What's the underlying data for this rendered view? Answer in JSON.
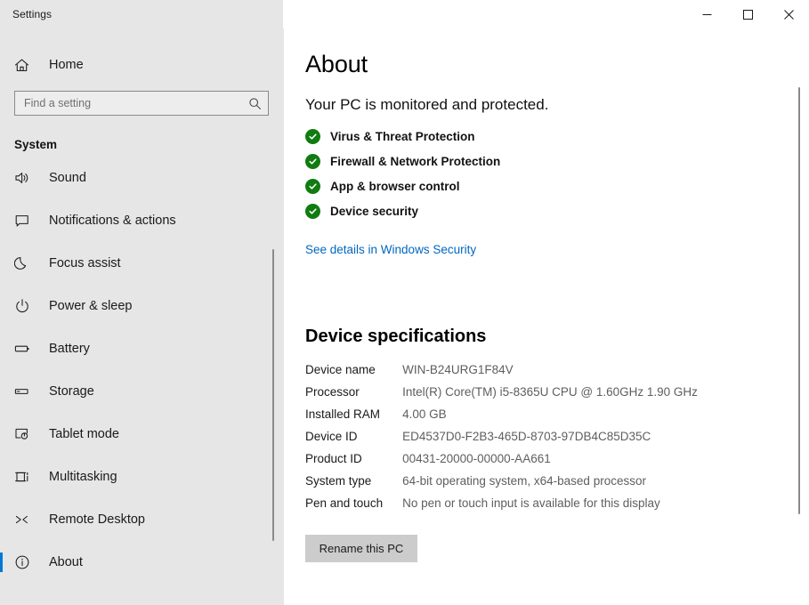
{
  "window": {
    "title": "Settings",
    "controls": {
      "minimize": "Minimize",
      "maximize": "Maximize",
      "close": "Close"
    }
  },
  "sidebar": {
    "home_label": "Home",
    "home_icon": "home-icon",
    "search": {
      "placeholder": "Find a setting",
      "value": "",
      "icon": "search-icon"
    },
    "group_title": "System",
    "items": [
      {
        "label": "Sound",
        "icon": "speaker-icon",
        "selected": false
      },
      {
        "label": "Notifications & actions",
        "icon": "notification-icon",
        "selected": false
      },
      {
        "label": "Focus assist",
        "icon": "moon-icon",
        "selected": false
      },
      {
        "label": "Power & sleep",
        "icon": "power-icon",
        "selected": false
      },
      {
        "label": "Battery",
        "icon": "battery-icon",
        "selected": false
      },
      {
        "label": "Storage",
        "icon": "storage-icon",
        "selected": false
      },
      {
        "label": "Tablet mode",
        "icon": "tablet-icon",
        "selected": false
      },
      {
        "label": "Multitasking",
        "icon": "multitasking-icon",
        "selected": false
      },
      {
        "label": "Remote Desktop",
        "icon": "remote-desktop-icon",
        "selected": false
      },
      {
        "label": "About",
        "icon": "info-icon",
        "selected": true
      }
    ]
  },
  "main": {
    "page_title": "About",
    "subtitle": "Your PC is monitored and protected.",
    "security_status": [
      {
        "label": "Virus & Threat Protection",
        "icon": "check-circle-icon",
        "state": "ok"
      },
      {
        "label": "Firewall & Network Protection",
        "icon": "check-circle-icon",
        "state": "ok"
      },
      {
        "label": "App & browser control",
        "icon": "check-circle-icon",
        "state": "ok"
      },
      {
        "label": "Device security",
        "icon": "check-circle-icon",
        "state": "ok"
      }
    ],
    "security_link": "See details in Windows Security",
    "device_specifications": {
      "heading": "Device specifications",
      "rows": [
        {
          "label": "Device name",
          "value": "WIN-B24URG1F84V"
        },
        {
          "label": "Processor",
          "value": "Intel(R) Core(TM) i5-8365U CPU @ 1.60GHz   1.90 GHz"
        },
        {
          "label": "Installed RAM",
          "value": "4.00 GB"
        },
        {
          "label": "Device ID",
          "value": "ED4537D0-F2B3-465D-8703-97DB4C85D35C"
        },
        {
          "label": "Product ID",
          "value": "00431-20000-00000-AA661"
        },
        {
          "label": "System type",
          "value": "64-bit operating system, x64-based processor"
        },
        {
          "label": "Pen and touch",
          "value": "No pen or touch input is available for this display"
        }
      ],
      "rename_button": "Rename this PC"
    }
  },
  "colors": {
    "accent": "#0078d7",
    "link": "#0067c0",
    "status_ok": "#107c10",
    "sidebar_bg": "#e6e6e6",
    "button_bg": "#cccccc"
  }
}
